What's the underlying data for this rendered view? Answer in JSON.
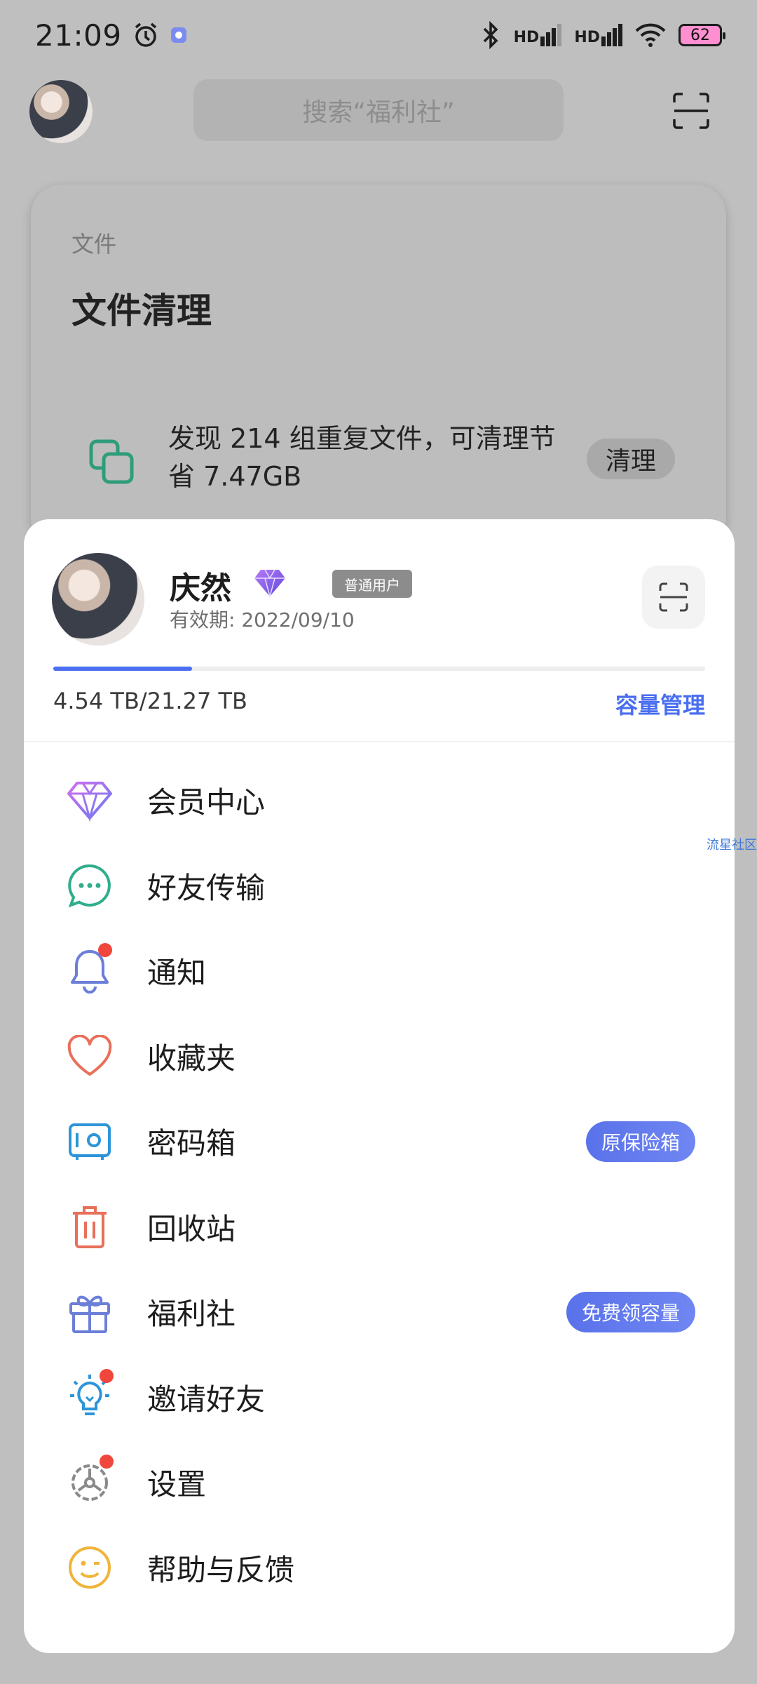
{
  "status_bar": {
    "time": "21:09",
    "battery": "62",
    "icons": [
      "alarm-icon",
      "app-notification-icon",
      "bluetooth-icon",
      "signal-hd-icon",
      "signal-hd-icon",
      "wifi-icon",
      "battery-icon"
    ],
    "hd_label": "HD"
  },
  "header": {
    "search_placeholder": "搜索“福利社”",
    "icons": [
      "avatar",
      "scan-icon"
    ]
  },
  "background_card": {
    "subtitle": "文件",
    "title": "文件清理",
    "message": "发现 214 组重复文件，可清理节省 7.47GB",
    "clean_button": "清理"
  },
  "drawer": {
    "user": {
      "name": "庆然",
      "badge": "普通用户",
      "validity": "有效期: 2022/09/10"
    },
    "storage": {
      "text": "4.54 TB/21.27 TB",
      "used_fraction": 0.2134,
      "manage_link": "容量管理"
    },
    "menu": [
      {
        "label": "会员中心",
        "icon": "diamond-icon"
      },
      {
        "label": "好友传输",
        "icon": "chat-bubble-icon"
      },
      {
        "label": "通知",
        "icon": "bell-icon",
        "dot": true
      },
      {
        "label": "收藏夹",
        "icon": "heart-icon"
      },
      {
        "label": "密码箱",
        "icon": "safe-icon",
        "pill": "原保险箱"
      },
      {
        "label": "回收站",
        "icon": "trash-icon"
      },
      {
        "label": "福利社",
        "icon": "gift-icon",
        "pill": "免费领容量"
      },
      {
        "label": "邀请好友",
        "icon": "lightbulb-icon",
        "dot": true
      },
      {
        "label": "设置",
        "icon": "gear-icon",
        "dot": true
      },
      {
        "label": "帮助与反馈",
        "icon": "smile-icon"
      }
    ]
  },
  "watermark": "流星社区",
  "colors": {
    "accent": "#4a6ef0",
    "dim_overlay": "#bfbfbf",
    "red_dot": "#f0463c"
  }
}
